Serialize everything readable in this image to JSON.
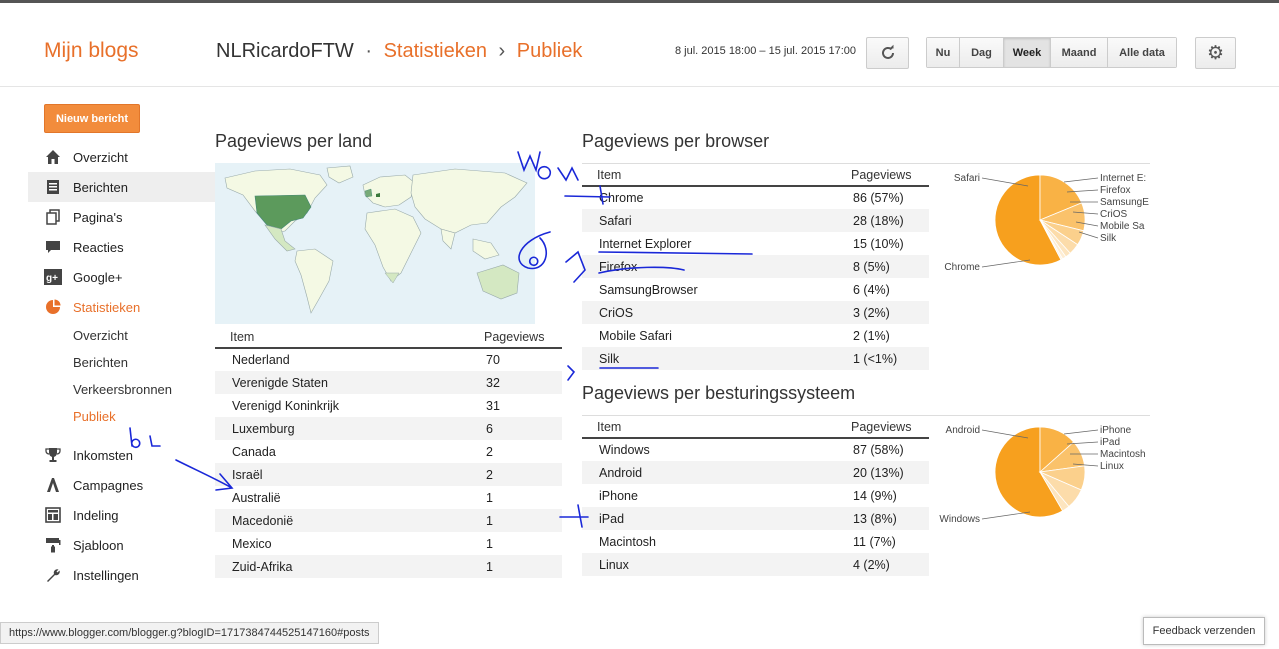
{
  "header": {
    "brand": "Mijn blogs",
    "blog_name": "NLRicardoFTW",
    "dot": "·",
    "section": "Statistieken",
    "chevron": "›",
    "page": "Publiek",
    "date_range": "8 jul. 2015 18:00 – 15 jul. 2015 17:00",
    "range_buttons": [
      "Nu",
      "Dag",
      "Week",
      "Maand",
      "Alle data"
    ],
    "active_range": "Week"
  },
  "sidebar": {
    "new_post": "Nieuw bericht",
    "items": [
      {
        "label": "Overzicht",
        "icon": "home-icon"
      },
      {
        "label": "Berichten",
        "icon": "posts-icon"
      },
      {
        "label": "Pagina's",
        "icon": "pages-icon"
      },
      {
        "label": "Reacties",
        "icon": "comments-icon"
      },
      {
        "label": "Google+",
        "icon": "googleplus-icon"
      },
      {
        "label": "Statistieken",
        "icon": "stats-icon"
      }
    ],
    "stats_sub": [
      "Overzicht",
      "Berichten",
      "Verkeersbronnen",
      "Publiek"
    ],
    "items_after": [
      {
        "label": "Inkomsten",
        "icon": "trophy-icon"
      },
      {
        "label": "Campagnes",
        "icon": "campaigns-icon"
      },
      {
        "label": "Indeling",
        "icon": "layout-icon"
      },
      {
        "label": "Sjabloon",
        "icon": "template-icon"
      },
      {
        "label": "Instellingen",
        "icon": "wrench-icon"
      }
    ]
  },
  "country": {
    "title": "Pageviews per land",
    "col_item": "Item",
    "col_views": "Pageviews",
    "rows": [
      [
        "Nederland",
        "70"
      ],
      [
        "Verenigde Staten",
        "32"
      ],
      [
        "Verenigd Koninkrijk",
        "31"
      ],
      [
        "Luxemburg",
        "6"
      ],
      [
        "Canada",
        "2"
      ],
      [
        "Israël",
        "2"
      ],
      [
        "Australië",
        "1"
      ],
      [
        "Macedonië",
        "1"
      ],
      [
        "Mexico",
        "1"
      ],
      [
        "Zuid-Afrika",
        "1"
      ]
    ]
  },
  "browser": {
    "title": "Pageviews per browser",
    "col_item": "Item",
    "col_views": "Pageviews",
    "rows": [
      [
        "Chrome",
        "86 (57%)"
      ],
      [
        "Safari",
        "28 (18%)"
      ],
      [
        "Internet Explorer",
        "15 (10%)"
      ],
      [
        "Firefox",
        "8 (5%)"
      ],
      [
        "SamsungBrowser",
        "6 (4%)"
      ],
      [
        "CriOS",
        "3 (2%)"
      ],
      [
        "Mobile Safari",
        "2 (1%)"
      ],
      [
        "Silk",
        "1 (<1%)"
      ]
    ],
    "pie_labels": [
      "Safari",
      "Chrome",
      "Internet E:",
      "Firefox",
      "SamsungE",
      "CriOS",
      "Mobile Sa",
      "Silk"
    ],
    "pie_values": [
      86,
      28,
      15,
      8,
      6,
      3,
      2,
      1
    ]
  },
  "os": {
    "title": "Pageviews per besturingssysteem",
    "col_item": "Item",
    "col_views": "Pageviews",
    "rows": [
      [
        "Windows",
        "87 (58%)"
      ],
      [
        "Android",
        "20 (13%)"
      ],
      [
        "iPhone",
        "14 (9%)"
      ],
      [
        "iPad",
        "13 (8%)"
      ],
      [
        "Macintosh",
        "11 (7%)"
      ],
      [
        "Linux",
        "4 (2%)"
      ]
    ],
    "pie_labels": [
      "Android",
      "Windows",
      "iPhone",
      "iPad",
      "Macintosh",
      "Linux"
    ],
    "pie_values": [
      87,
      20,
      14,
      13,
      11,
      4
    ]
  },
  "colors": {
    "orange": "#e8702a",
    "pie_main": "#f7a01e",
    "map_high": "#5c9a5c",
    "map_low": "#f7fbe9"
  },
  "status_url": "https://www.blogger.com/blogger.g?blogID=1717384744525147160#posts",
  "feedback": "Feedback verzenden"
}
